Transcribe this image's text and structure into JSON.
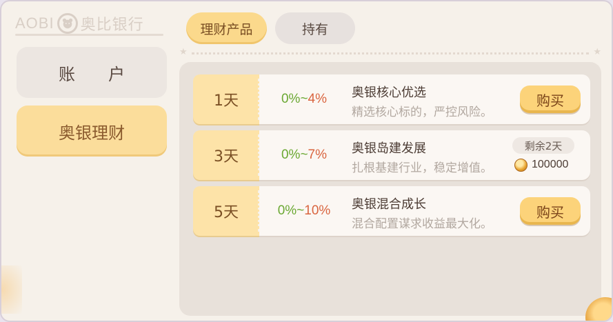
{
  "logo": {
    "latin": "AOBI",
    "chinese": "奥比银行"
  },
  "sidebar": {
    "items": [
      {
        "label": "账户"
      },
      {
        "label": "奥银理财"
      }
    ]
  },
  "tabs": [
    {
      "label": "理财产品",
      "selected": true
    },
    {
      "label": "持有",
      "selected": false
    }
  ],
  "products": [
    {
      "term": "1天",
      "rate_low": "0%",
      "rate_sep": "~",
      "rate_high": "4%",
      "name": "奥银核心优选",
      "description": "精选核心标的，严控风险。",
      "action": {
        "type": "button",
        "label": "购买"
      }
    },
    {
      "term": "3天",
      "rate_low": "0%",
      "rate_sep": "~",
      "rate_high": "7%",
      "name": "奥银岛建发展",
      "description": "扎根基建行业，稳定增值。",
      "action": {
        "type": "holding",
        "remaining": "剩余2天",
        "amount": "100000"
      }
    },
    {
      "term": "5天",
      "rate_low": "0%",
      "rate_sep": "~",
      "rate_high": "10%",
      "name": "奥银混合成长",
      "description": "混合配置谋求收益最大化。",
      "action": {
        "type": "button",
        "label": "购买"
      }
    }
  ],
  "colors": {
    "accent": "#fbd98c",
    "rate_low": "#6aa832",
    "rate_high": "#d9643e"
  }
}
